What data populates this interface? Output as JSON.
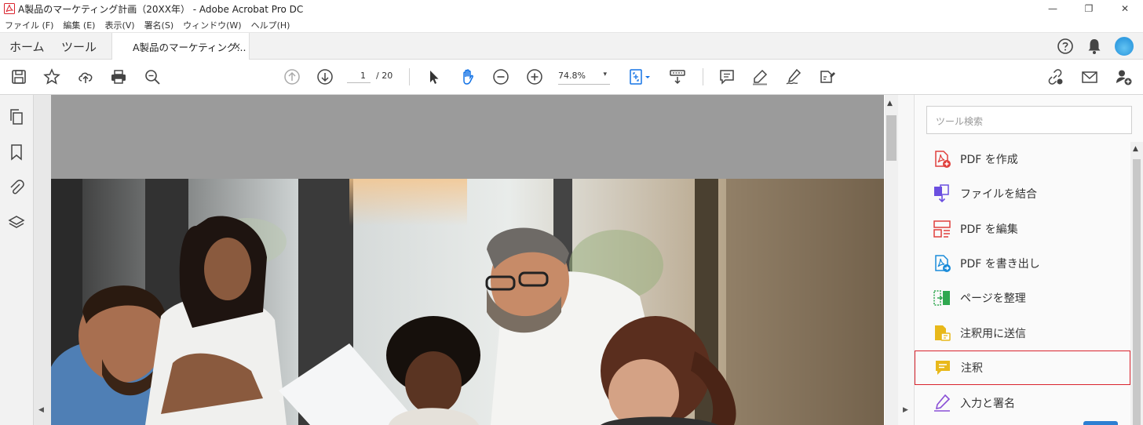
{
  "window": {
    "title": "A製品のマーケティング計画（20XX年） - Adobe Acrobat Pro DC",
    "controls": {
      "minimize": "—",
      "restore": "❐",
      "close": "✕"
    }
  },
  "menu": [
    "ファイル (F)",
    "編集 (E)",
    "表示(V)",
    "署名(S)",
    "ウィンドウ(W)",
    "ヘルプ(H)"
  ],
  "tabs": {
    "home": "ホーム",
    "tools": "ツール",
    "document": "A製品のマーケティング...",
    "close": "×"
  },
  "toolbar": {
    "page_current": "1",
    "page_total": "/ 20",
    "zoom": "74.8%",
    "zoom_caret": "▾"
  },
  "tools_pane": {
    "search_placeholder": "ツール検索",
    "items": [
      {
        "label": "PDF を作成",
        "icon": "create-pdf-icon",
        "color": "#e0403c"
      },
      {
        "label": "ファイルを結合",
        "icon": "combine-files-icon",
        "color": "#6b4fe0"
      },
      {
        "label": "PDF を編集",
        "icon": "edit-pdf-icon",
        "color": "#e0403c"
      },
      {
        "label": "PDF を書き出し",
        "icon": "export-pdf-icon",
        "color": "#1a8bd9"
      },
      {
        "label": "ページを整理",
        "icon": "organize-pages-icon",
        "color": "#2fa84f"
      },
      {
        "label": "注釈用に送信",
        "icon": "send-for-comments-icon",
        "color": "#e8b81a"
      },
      {
        "label": "注釈",
        "icon": "comment-icon",
        "color": "#e8b81a",
        "highlighted": true
      },
      {
        "label": "入力と署名",
        "icon": "fill-sign-icon",
        "color": "#8a4fd6"
      }
    ]
  },
  "colors": {
    "highlight_border": "#d9232d",
    "accent_blue": "#1473e6"
  }
}
